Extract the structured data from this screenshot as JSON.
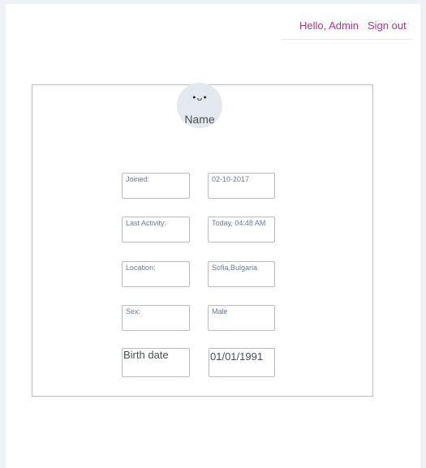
{
  "nav": {
    "greeting": "Hello, Admin",
    "sign_out": "Sign out"
  },
  "profile": {
    "avatar_face": "•ᴗ•",
    "name": "Name"
  },
  "fields": [
    {
      "label": "Joined:",
      "value": "02-10-2017"
    },
    {
      "label": "Last Activity:",
      "value": "Today, 04:48 AM"
    },
    {
      "label": "Location:",
      "value": "Sofia,Bulgaria"
    },
    {
      "label": "Sex:",
      "value": "Male"
    },
    {
      "label": "Birth date",
      "value": "01/01/1991"
    }
  ],
  "colors": {
    "link": "#b0378f",
    "field_text": "#6b7a99",
    "border": "#b9bcc2",
    "page_bg": "#eef1f5"
  }
}
